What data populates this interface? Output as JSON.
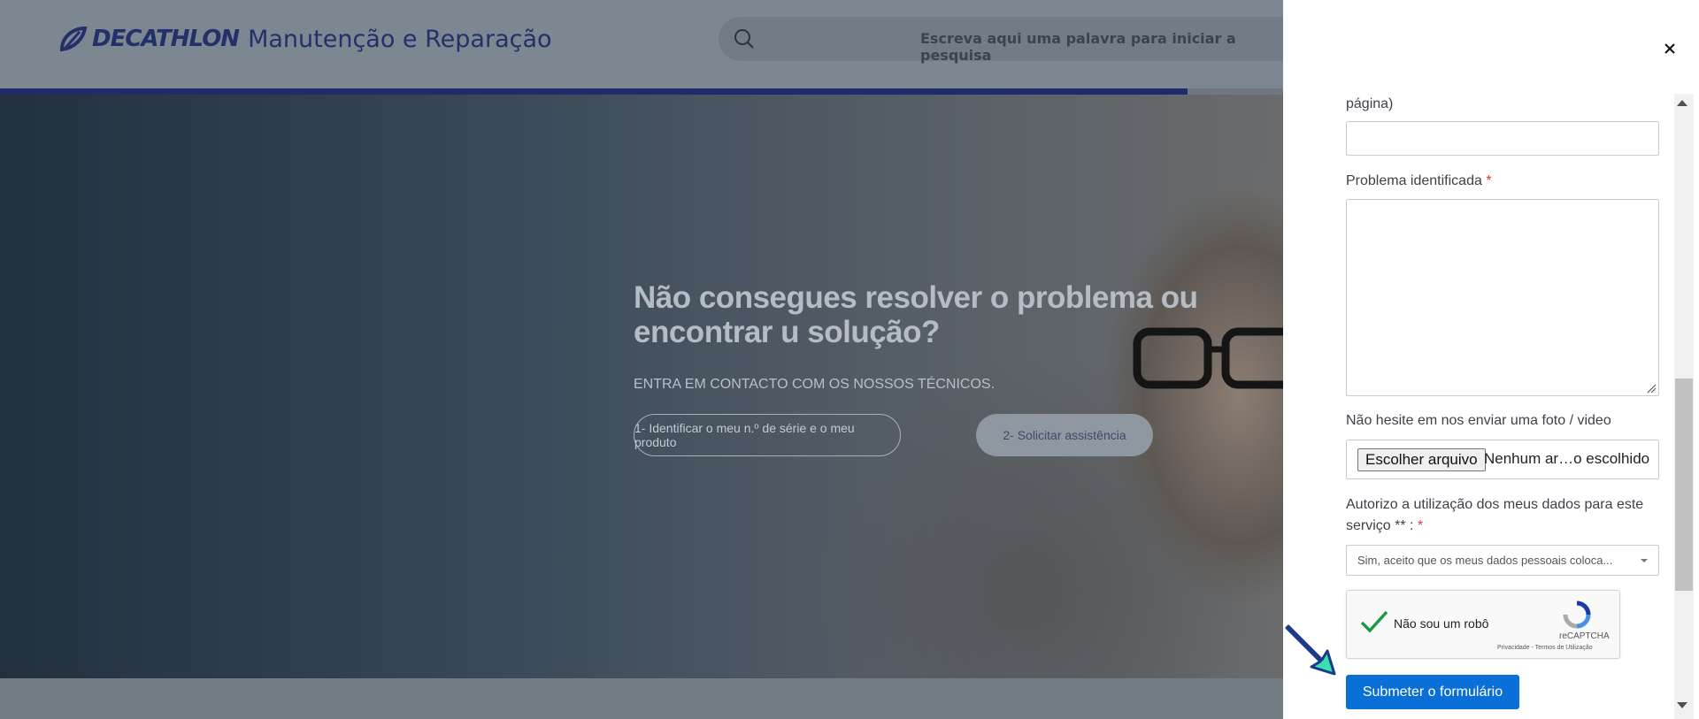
{
  "header": {
    "brand": "DECATHLON",
    "subtitle": "Manutenção e Reparação",
    "search_placeholder": "Escreva aqui uma palavra para iniciar a pesquisa"
  },
  "hero": {
    "title": "Não consegues resolver o problema ou encontrar u solução?",
    "subtitle": "ENTRA EM CONTACTO COM OS NOSSOS TÉCNICOS.",
    "button_identify": "1- Identificar o meu n.º de série e o meu produto",
    "button_assistance": "2- Solicitar assistência"
  },
  "form": {
    "close_label": "×",
    "partial_label": "página)",
    "problem_label": "Problema identificada",
    "required_mark": "*",
    "photo_label": "Não hesite em nos enviar uma foto / video",
    "file_button": "Escolher arquivo",
    "file_status": "Nenhum ar…o escolhido",
    "consent_label": "Autorizo a utilização dos meus dados para este serviço ** :",
    "consent_value": "Sim, aceito que os meus dados pessoais coloca...",
    "captcha_label": "Não sou um robô",
    "captcha_brand": "reCAPTCHA",
    "captcha_links": "Privacidade - Termos de Utilização",
    "submit_label": "Submeter o formulário"
  },
  "colors": {
    "brand": "#23306a",
    "submit": "#0a6fd6",
    "required": "#e03b3b",
    "pointer": "#3be0b0"
  }
}
